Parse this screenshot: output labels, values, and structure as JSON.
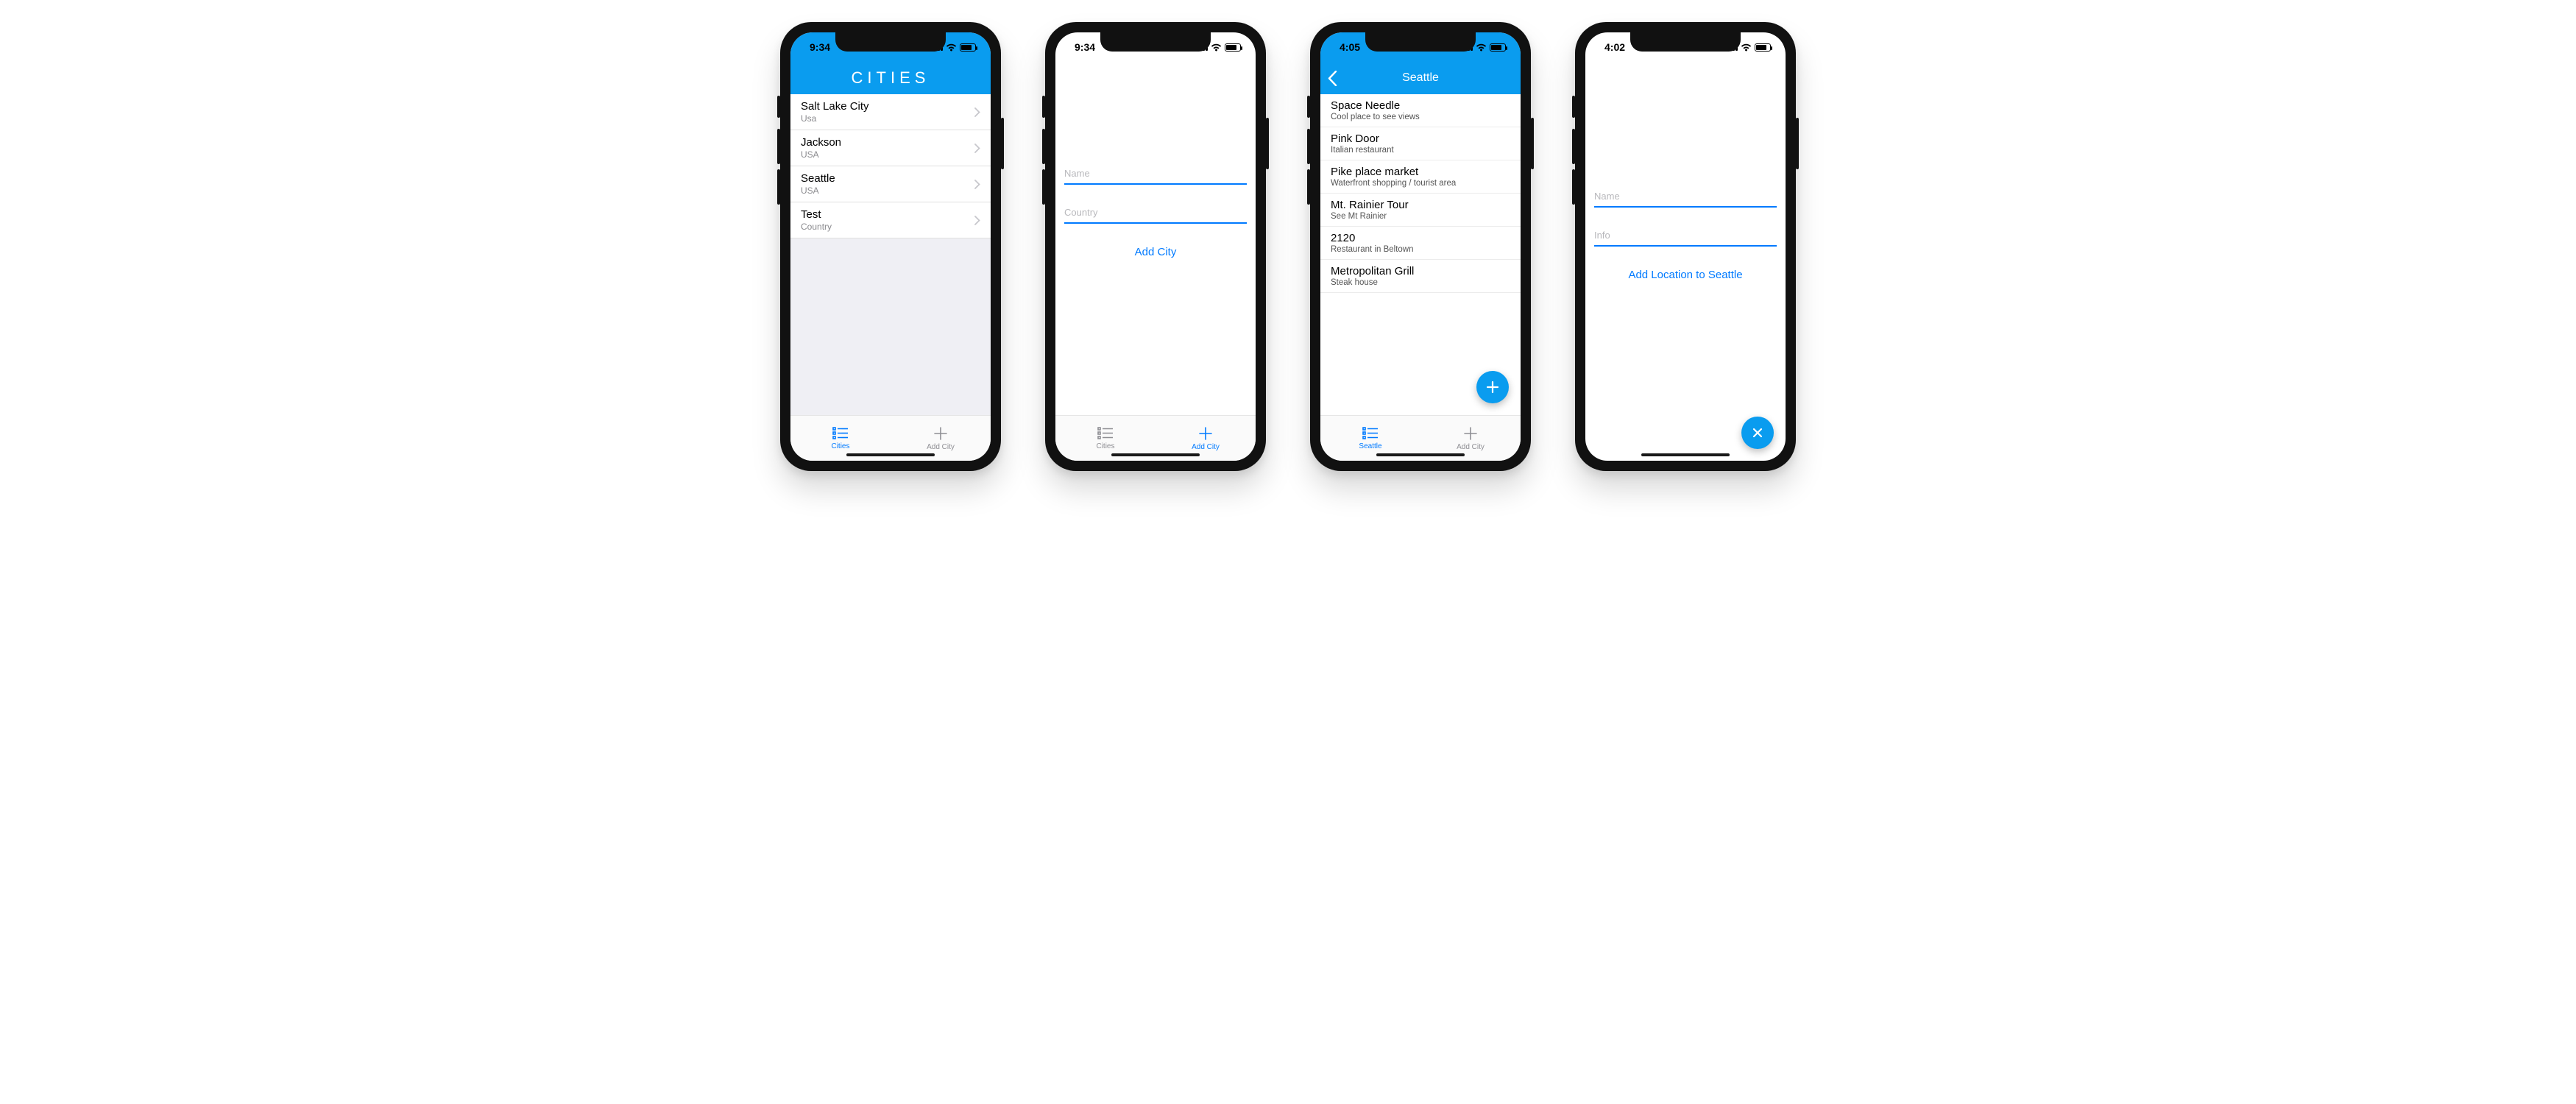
{
  "colors": {
    "brand": "#0a9cef",
    "ios_blue": "#007aff"
  },
  "screen1": {
    "time": "9:34",
    "nav_title": "CITIES",
    "cities": [
      {
        "name": "Salt Lake City",
        "country": "Usa"
      },
      {
        "name": "Jackson",
        "country": "USA"
      },
      {
        "name": "Seattle",
        "country": "USA"
      },
      {
        "name": "Test",
        "country": "Country"
      }
    ],
    "tabs": {
      "cities": "Cities",
      "add_city": "Add City",
      "active": "cities"
    }
  },
  "screen2": {
    "time": "9:34",
    "name_placeholder": "Name",
    "country_placeholder": "Country",
    "submit_label": "Add City",
    "tabs": {
      "cities": "Cities",
      "add_city": "Add City",
      "active": "add_city"
    }
  },
  "screen3": {
    "time": "4:05",
    "nav_title": "Seattle",
    "places": [
      {
        "name": "Space Needle",
        "info": "Cool place to see views"
      },
      {
        "name": "Pink Door",
        "info": "Italian restaurant"
      },
      {
        "name": "Pike place market",
        "info": "Waterfront shopping / tourist area"
      },
      {
        "name": "Mt. Rainier Tour",
        "info": "See Mt Rainier"
      },
      {
        "name": "2120",
        "info": "Restaurant in Beltown"
      },
      {
        "name": "Metropolitan Grill",
        "info": "Steak house"
      }
    ],
    "tabs": {
      "city": "Seattle",
      "add_city": "Add City",
      "active": "city"
    },
    "fab_icon": "plus"
  },
  "screen4": {
    "time": "4:02",
    "name_placeholder": "Name",
    "info_placeholder": "Info",
    "submit_label": "Add Location to Seattle",
    "fab_icon": "close"
  }
}
